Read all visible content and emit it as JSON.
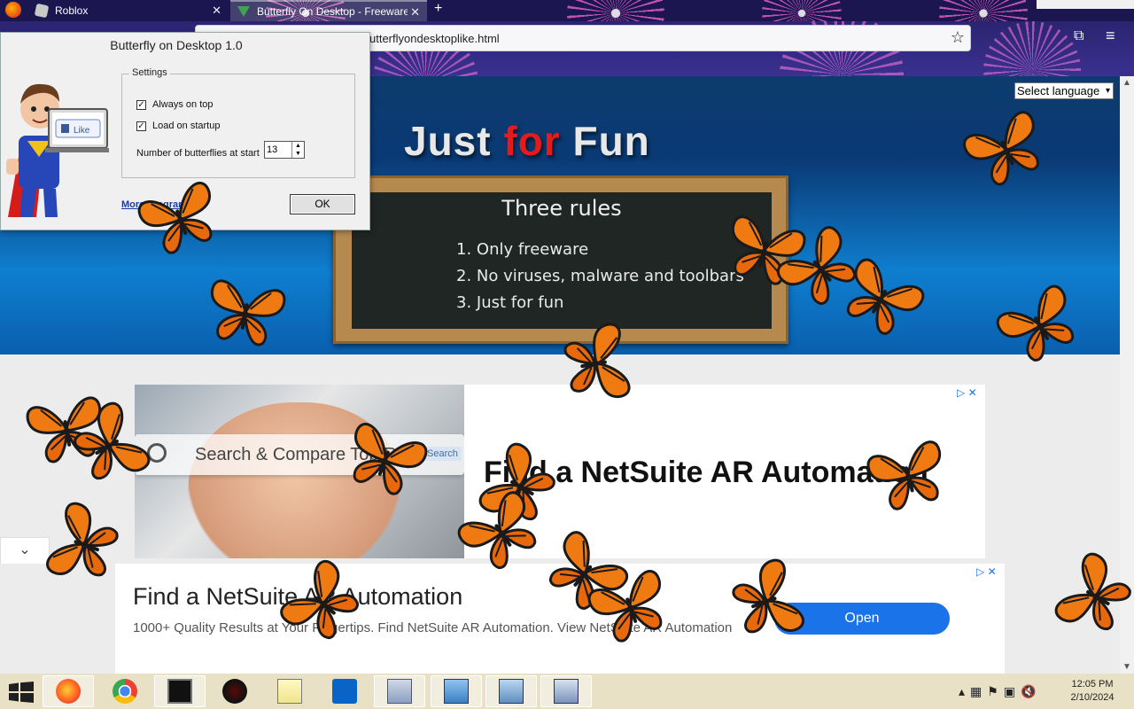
{
  "browser": {
    "tabs": [
      {
        "label": "Roblox",
        "icon": "roblox-icon"
      },
      {
        "label": "Butterfly On Desktop - Freeware",
        "icon": "download-icon"
      }
    ],
    "url": "utterflyondesktoplike.html",
    "firefox_logo": "firefox-logo-icon"
  },
  "page": {
    "hero_title_a": "Just ",
    "hero_title_b": "for",
    "hero_title_c": " Fun",
    "board_title": "Three rules",
    "rules": [
      "1. Only freeware",
      "2. No viruses, malware and toolbars",
      "3. Just for fun"
    ],
    "language_select": "Select language",
    "ad1": {
      "search_text": "Search & Compare Top Res",
      "search_button": "Search",
      "headline": "Find a NetSuite AR Automation"
    },
    "ad2": {
      "headline": "Find a NetSuite AR Automation",
      "body": "1000+ Quality Results at Your Fingertips. Find NetSuite AR Automation. View NetSuite AR Automation",
      "button": "Open"
    }
  },
  "dialog": {
    "title": "Butterfly on Desktop 1.0",
    "settings_legend": "Settings",
    "always_on_top": "Always on top",
    "always_on_top_checked": true,
    "load_on_startup": "Load on startup",
    "load_on_startup_checked": true,
    "count_label": "Number of butterflies at start",
    "count_value": "13",
    "more_link": "More programs",
    "ok": "OK",
    "like_label": "Like"
  },
  "taskbar": {
    "apps": [
      "firefox",
      "chrome",
      "command-prompt",
      "obs",
      "notepad",
      "outlook",
      "performance-monitor",
      "control-panel",
      "network",
      "remote-desktop"
    ],
    "clock_time": "12:05 PM",
    "clock_date": "2/10/2024"
  },
  "colors": {
    "butterfly_orange": "#f07a12",
    "accent_blue": "#1a73e8",
    "taskbar": "#e8e1c5"
  }
}
